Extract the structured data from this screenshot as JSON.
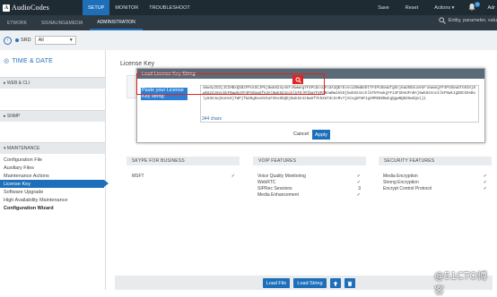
{
  "brand": {
    "name": "AudioCodes"
  },
  "top_tabs": [
    "SETUP",
    "MONITOR",
    "TROUBLESHOOT"
  ],
  "top_actions": {
    "save": "Save",
    "reset": "Reset",
    "actions": "Actions ▾",
    "bell_count": "0",
    "user": "Adr"
  },
  "sub_tabs": [
    "ETWORK",
    "SIGNALING&MEDIA",
    "ADMINISTRATION"
  ],
  "search": {
    "placeholder": "Entity, parameter, valu"
  },
  "filter": {
    "srd_label": "SRD",
    "srd_value": "All"
  },
  "sidebar": {
    "heading": "TIME & DATE",
    "web_cli": "WEB & CLI",
    "snmp": "SNMP",
    "maintenance": "MAINTENANCE",
    "items": [
      "Configuration File",
      "Auxiliary Files",
      "Maintenance Actions",
      "License Key",
      "Software Upgrade",
      "High Availability Maintenance",
      "Configuration Wizard"
    ]
  },
  "main": {
    "title": "License Key",
    "skype": {
      "heading": "SKYPE FOR BUSINESS",
      "rows": [
        {
          "label": "MSFT",
          "value": "✓"
        }
      ]
    },
    "voip": {
      "heading": "VOIP FEATURES",
      "rows": [
        {
          "label": "Voice Quality Monitoring",
          "value": "✓"
        },
        {
          "label": "WebRTC",
          "value": "✓"
        },
        {
          "label": "SIPRec Sessions",
          "value": "3"
        },
        {
          "label": "Media Enhancement",
          "value": "✓"
        }
      ]
    },
    "security": {
      "heading": "SECURITY FEATURES",
      "rows": [
        {
          "label": "Media Encryption",
          "value": "✓"
        },
        {
          "label": "Strong Encryption",
          "value": "✓"
        },
        {
          "label": "Encrypt Control Protocol",
          "value": "✓"
        }
      ]
    },
    "buttons": {
      "load_file": "Load File",
      "load_string": "Load String"
    }
  },
  "dialog": {
    "title": "Load License Key String",
    "label": "Paste your License Key string:",
    "text": "omw4yID3jJCIHBxQS8zFPckSCJPkj8wk824yskFlKwwegYF4PcDolUFn3A1QErExsoiOHwBeDtYF4PcBowUfgOojkwUhBouokkFlkwwkgYF4PcBowUfn03Aj8wk824z8ockkF8wwkgYF4PcBowUfn3Aj8wk824ocklkF8jMjbwYF4PcBowBw1kk8jkwk824ocklkFkPowkgYF13FSDeUFn0Aj8wk824ocklkF0wkJgDDCk0sBoly83HJwjKxHv9jTWPjfmZ0gDavD4IaFXKx0bQDj8wk824z8wUfYkbXmTdcSsMv7jACogUFmPJgAMMkBZBwkgQgwNQDZ8wkQoiji",
    "chars": "344 chars",
    "cancel": "Cancel",
    "apply": "Apply"
  },
  "watermark": "@51CTO博客",
  "colors": {
    "accent": "#1e6fba",
    "topbar": "#1e2b33",
    "highlight": "#e02323"
  }
}
